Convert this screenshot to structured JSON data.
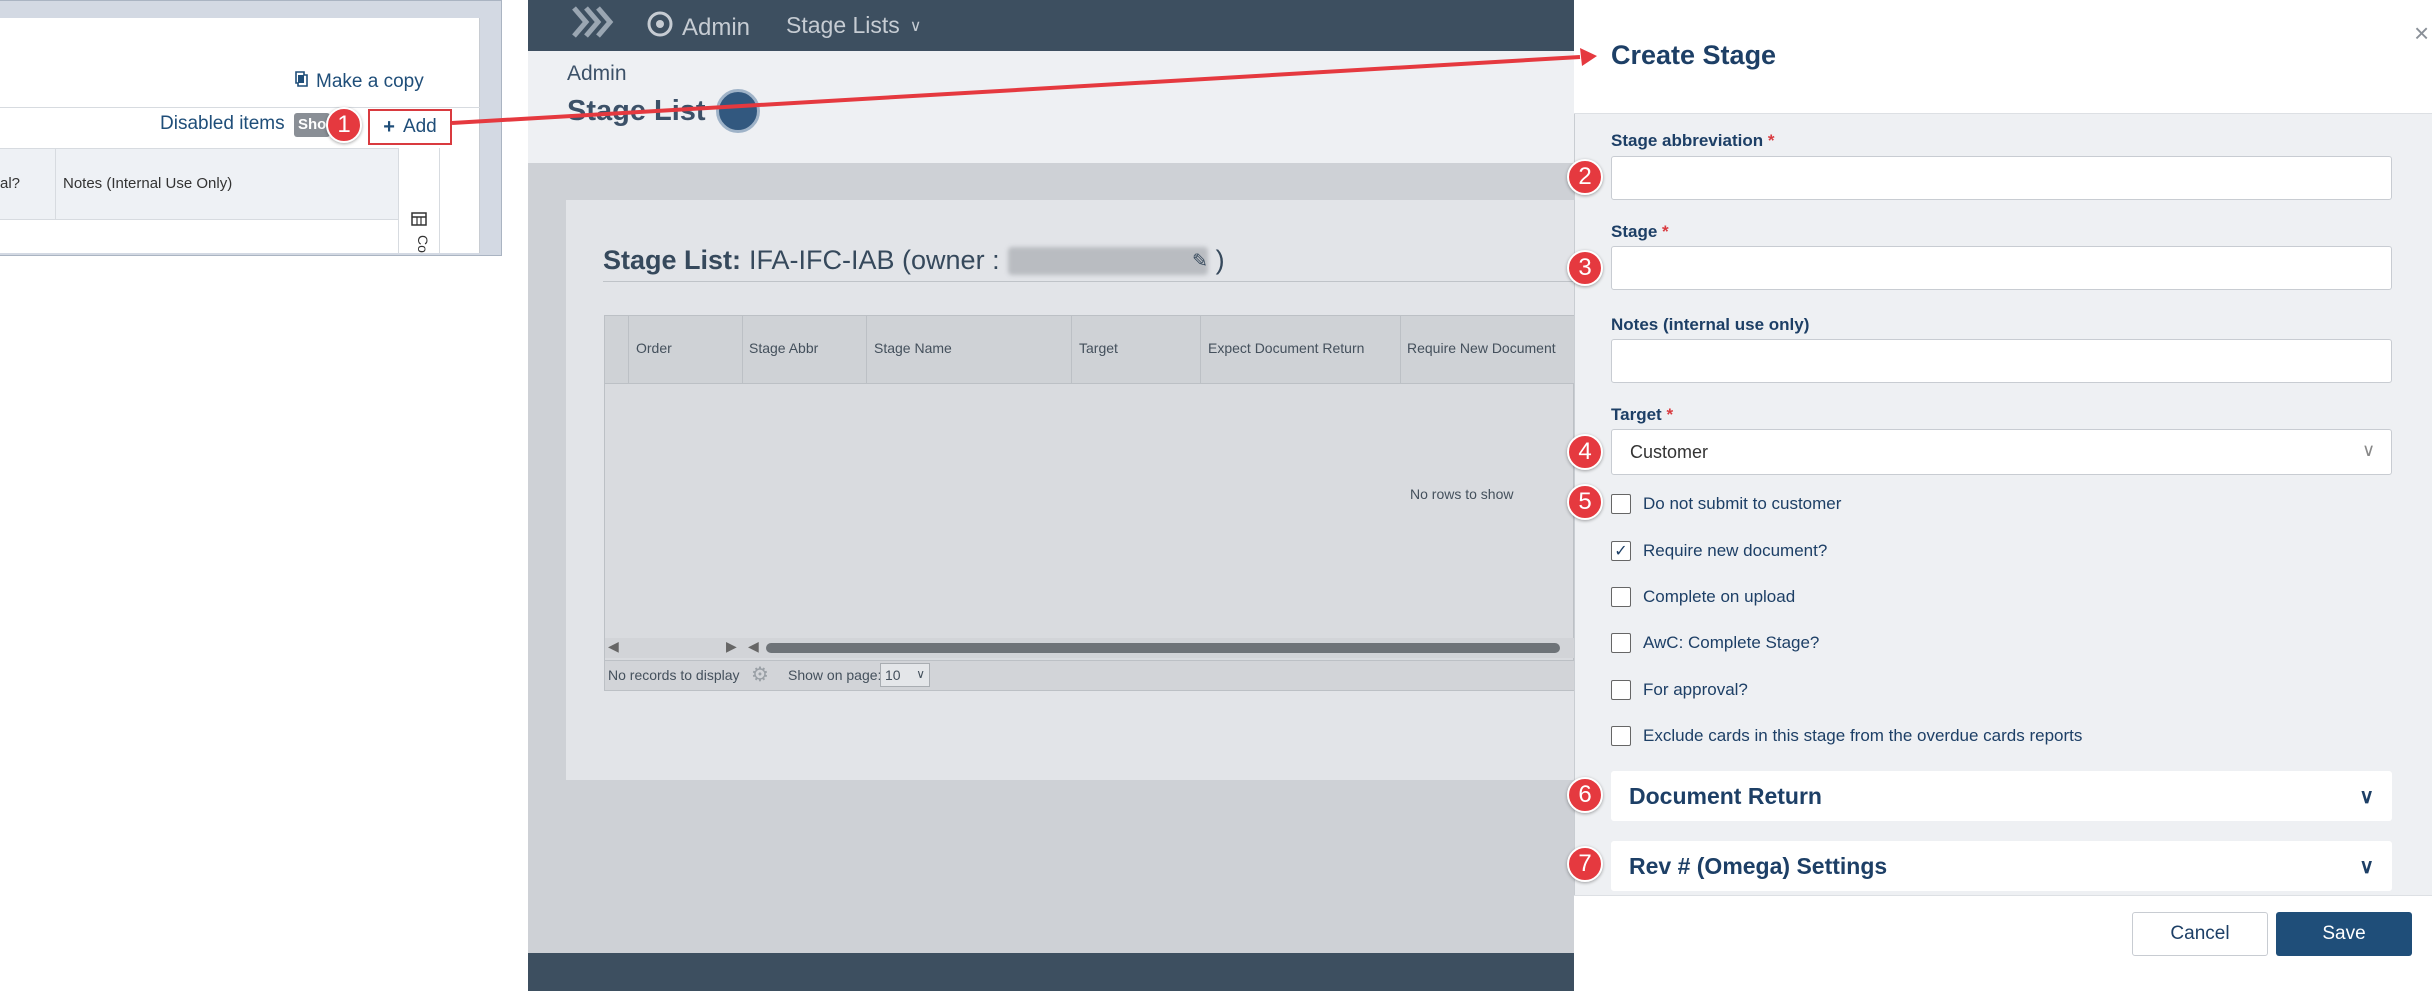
{
  "inset": {
    "make_copy_label": "Make a copy",
    "disabled_items_label": "Disabled items",
    "show_chip_label": "Show",
    "add_label": "Add",
    "col_a": "al?",
    "col_b": "Notes (Internal Use Only)",
    "col_letter": "Co"
  },
  "callouts": [
    "1",
    "2",
    "3",
    "4",
    "5",
    "6",
    "7"
  ],
  "app": {
    "nav": {
      "admin": "Admin",
      "stage_lists": "Stage Lists"
    },
    "header": {
      "section": "Admin",
      "title": "Stage List"
    },
    "stage_list_prefix": "Stage List:",
    "stage_list_name": "IFA-IFC-IAB (owner :",
    "stage_list_close": ")",
    "grid": {
      "columns": [
        "Order",
        "Stage Abbr",
        "Stage Name",
        "Target",
        "Expect Document Return",
        "Require New Document"
      ],
      "empty_text": "No rows to show",
      "no_records": "No records to display",
      "show_on_page": "Show on page:",
      "page_size": "10"
    }
  },
  "drawer": {
    "title": "Create Stage",
    "fields": {
      "abbr_label": "Stage abbreviation",
      "stage_label": "Stage",
      "notes_label": "Notes (internal use only)",
      "target_label": "Target",
      "target_value": "Customer",
      "required_mark": "*"
    },
    "checkboxes": [
      {
        "label": "Do not submit to customer",
        "checked": false
      },
      {
        "label": "Require new document?",
        "checked": true
      },
      {
        "label": "Complete on upload",
        "checked": false
      },
      {
        "label": "AwC: Complete Stage?",
        "checked": false
      },
      {
        "label": "For approval?",
        "checked": false
      },
      {
        "label": "Exclude cards in this stage from the overdue cards reports",
        "checked": false
      }
    ],
    "sections": [
      "Document Return",
      "Rev # (Omega) Settings"
    ],
    "cancel_label": "Cancel",
    "save_label": "Save"
  },
  "colors": {
    "accent": "#1f4e79",
    "callout": "#e5393f",
    "nav": "#3d4f60"
  }
}
